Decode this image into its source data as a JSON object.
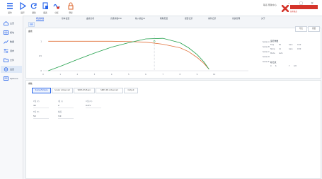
{
  "toolbar": {
    "items": [
      {
        "icon": "menu-icon",
        "label": "菜单"
      },
      {
        "icon": "play-icon",
        "label": "运行"
      },
      {
        "icon": "refresh-icon",
        "label": "刷新"
      },
      {
        "icon": "document-icon",
        "label": "报表"
      },
      {
        "icon": "wave-icon",
        "label": "分析"
      },
      {
        "icon": "lock-icon",
        "label": "登录"
      }
    ],
    "status_text": "联系 帮助中心",
    "logo_text": "技术频道",
    "colors": {
      "accent": "#2563eb",
      "logo_red": "#d4342a",
      "green_curve": "#22a04b",
      "orange_curve": "#e0703a"
    }
  },
  "sidebar": {
    "items": [
      {
        "icon": "home-icon",
        "label": "主页"
      },
      {
        "icon": "grid-icon",
        "label": "模块"
      },
      {
        "icon": "chart-icon",
        "label": "数据"
      },
      {
        "icon": "sliders-icon",
        "label": "调参"
      },
      {
        "icon": "folder-icon",
        "label": "文件"
      },
      {
        "icon": "settings-icon",
        "label": "设置"
      },
      {
        "icon": "list-icon",
        "label": "Options"
      }
    ],
    "active_index": 5
  },
  "tabs": [
    "概述参数",
    "基本设置",
    "曲线分析",
    "高级参数PID",
    "输入输出IO",
    "辅助配置",
    "报警记录",
    "事件记录",
    "系统管理",
    "关于"
  ],
  "active_tab": 0,
  "sub_chip": "曲线",
  "curve_panel": {
    "title": "曲线",
    "right_buttons": [
      "导出",
      "重置"
    ],
    "info_title": "运行参数",
    "info_rows": [
      {
        "k": "Freq",
        "v": "50",
        "k2": "Gain",
        "v2": "0.50"
      },
      {
        "k": "Temp",
        "v": "21",
        "k2": "Gain",
        "v2": "0.50"
      },
      {
        "k": "Mode",
        "v": "Auto",
        "k2": "",
        "v2": ""
      }
    ],
    "marker_title": "标记点",
    "marker_rows": [
      {
        "k": "X",
        "v": "6"
      },
      {
        "k": "Y",
        "v": "0.8"
      }
    ],
    "legend": [
      "Series A",
      "Series B",
      "Series C",
      "Series D",
      "Series E"
    ]
  },
  "chart_data": {
    "type": "line",
    "title": "",
    "xlabel": "",
    "ylabel": "",
    "xlim": [
      0,
      12
    ],
    "ylim": [
      0,
      1.2
    ],
    "x_ticks": [
      "0",
      "1",
      "2",
      "3",
      "4",
      "5",
      "6",
      "7",
      "8",
      "9",
      "10"
    ],
    "y_ticks": [
      "1",
      "0.5",
      "0"
    ],
    "series": [
      {
        "color": "#e0703a",
        "x": [
          0.3,
          1,
          2,
          3,
          4,
          5,
          6,
          7,
          8,
          8.5,
          9,
          9.4,
          9.7
        ],
        "y": [
          1.0,
          1.0,
          1.0,
          1.0,
          1.0,
          0.99,
          0.97,
          0.9,
          0.78,
          0.65,
          0.45,
          0.25,
          0.05
        ]
      },
      {
        "color": "#22a04b",
        "x": [
          0.3,
          1,
          2,
          3,
          4,
          5,
          6,
          7,
          8,
          8.5,
          9,
          9.4,
          9.7
        ],
        "y": [
          0.0,
          0.15,
          0.38,
          0.6,
          0.8,
          0.95,
          1.08,
          1.1,
          0.95,
          0.78,
          0.55,
          0.3,
          0.05
        ]
      }
    ],
    "marker": {
      "x": 6.5,
      "y": 1.0
    }
  },
  "params_panel": {
    "title": "参数",
    "modes": [
      "Scalar/Simple",
      "Scalar Advanced",
      "SRRS RS Basic",
      "SRRS RS Advanced",
      "Output"
    ],
    "active_mode": 0,
    "fields": [
      {
        "label": "P值 (P)",
        "value": "40"
      },
      {
        "label": "I值 (I)",
        "value": "2"
      },
      {
        "label": "D值 (D)",
        "value": "0.8 V"
      },
      {
        "label": "F值 (F)",
        "value": "50"
      },
      {
        "label": "幅度",
        "value": "3.0"
      }
    ]
  }
}
